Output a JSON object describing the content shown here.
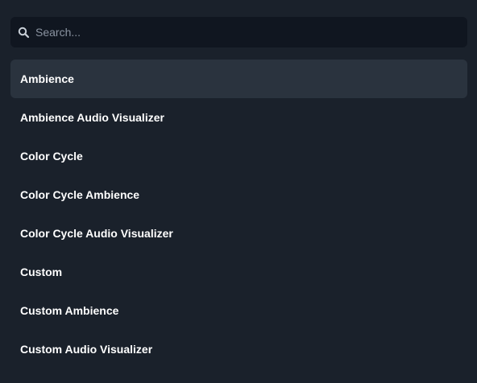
{
  "search": {
    "placeholder": "Search...",
    "value": "",
    "icon": "search-icon"
  },
  "selected_index": 0,
  "colors": {
    "background": "#1a212b",
    "search_background": "#101620",
    "selected_background": "#2a333e",
    "text": "#ffffff",
    "placeholder": "#8a93a0"
  },
  "items": [
    {
      "label": "Ambience"
    },
    {
      "label": "Ambience Audio Visualizer"
    },
    {
      "label": "Color Cycle"
    },
    {
      "label": "Color Cycle Ambience"
    },
    {
      "label": "Color Cycle Audio Visualizer"
    },
    {
      "label": "Custom"
    },
    {
      "label": "Custom Ambience"
    },
    {
      "label": "Custom Audio Visualizer"
    }
  ]
}
